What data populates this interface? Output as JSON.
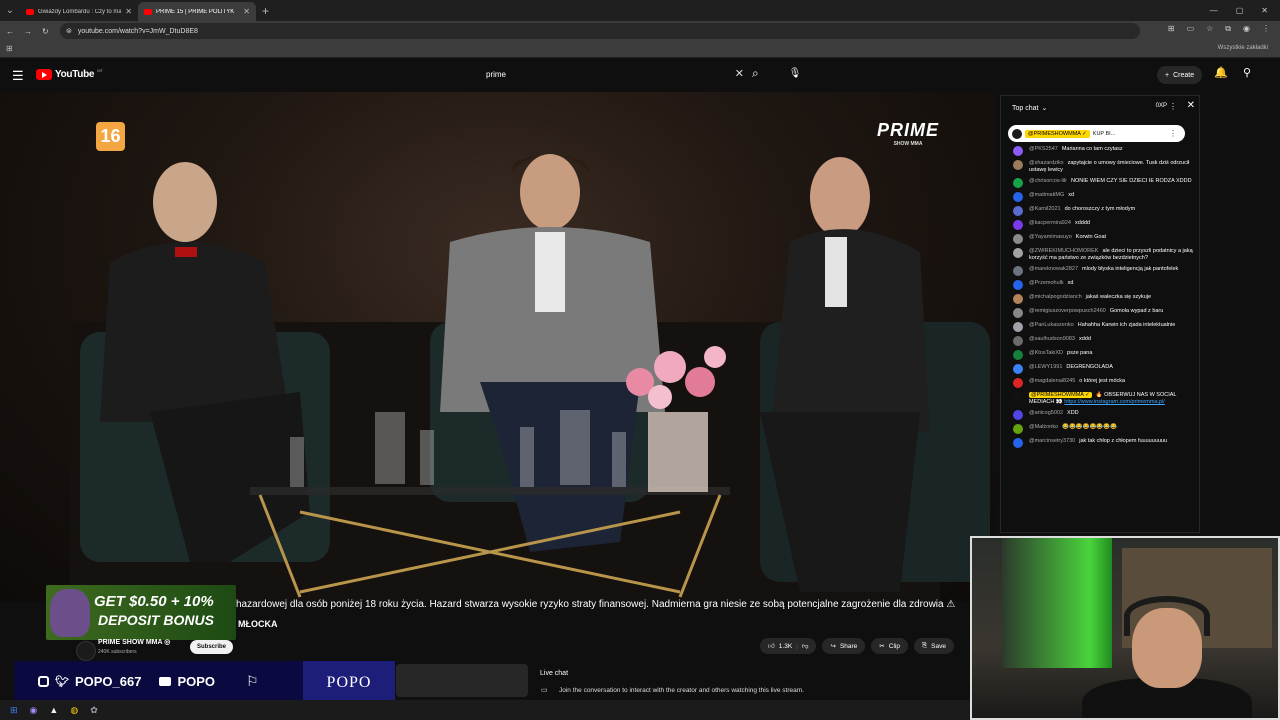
{
  "browser": {
    "tabs": [
      {
        "title": "Gwiazdy Lombardu : Czy to ma",
        "active": false
      },
      {
        "title": "PRIME 15 | PRIME POLITYK",
        "active": true
      }
    ],
    "url": "youtube.com/watch?v=JmW_DtuD8E8",
    "bookmarks_all": "Wszystkie zakładki"
  },
  "youtube": {
    "logo": "YouTube",
    "country_code": "MT",
    "search_value": "prime",
    "create_label": "Create"
  },
  "video": {
    "age_rating": "16",
    "brand": "PRIME",
    "brand_sub": "SHOW MMA",
    "ticker": "hazardowej dla osób poniżej 18 roku życia. Hazard stwarza wysokie ryzyko straty finansowej. Nadmierna gra niesie ze sobą potencjalne zagrożenie dla zdrowia ⚠",
    "guest_name": "MŁOCKA",
    "ad_line1": "GET $0.50 + 10%",
    "ad_line2": "DEPOSIT BONUS"
  },
  "channel": {
    "name": "PRIME SHOW MMA",
    "verified": "◎",
    "subscribers": "240K subscribers",
    "subscribe_label": "Subscribe"
  },
  "actions": {
    "likes": "1.3K",
    "share": "Share",
    "clip": "Clip",
    "save": "Save"
  },
  "overlay": {
    "handle": "POPO_667",
    "yt_name": "POPO",
    "box_text": "POPO"
  },
  "live_chat_bar": {
    "title": "Live chat",
    "description": "Join the conversation to interact with the creator and others watching this live stream."
  },
  "chat": {
    "header": "Top chat",
    "xp": "0XP",
    "pinned": {
      "author": "@PRIMESHOWMMA ✓",
      "text": "KUP BI..."
    },
    "messages": [
      {
        "author": "@PKS2547",
        "text": "Marianna co tam czytasz",
        "color": "#8b5cf6"
      },
      {
        "author": "@shazardzikx",
        "text": "zapytajcie o umowy śmieciowe. Tusk dziś odrzucił ustawę lewicy",
        "color": "#9a7b5a"
      },
      {
        "author": "@chrisorcos-lilr",
        "text": "NONIE WIEM CZY SIE DZIECI IE RODZA XDDD",
        "color": "#16a34a"
      },
      {
        "author": "@matimatiMG",
        "text": "xd",
        "color": "#2563eb"
      },
      {
        "author": "@Kamil2021",
        "text": "do choroszczy z tym młodym",
        "color": "#5b6bd0"
      },
      {
        "author": "@kacpermira924",
        "text": "xdddd",
        "color": "#7c3aed"
      },
      {
        "author": "@Yayamimasuyo",
        "text": "Korwin Goat",
        "color": "#8a8a8a"
      },
      {
        "author": "@ZWIREKIMUCHOMOREK",
        "text": "ale dzieci to przyszli podatnicy a jaką korzyść ma państwo ze związków bezdzietnych?",
        "color": "#a3a3a3"
      },
      {
        "author": "@mareknowak2827",
        "text": "mlody błyska inteligencją jak pantofelek",
        "color": "#6b7280"
      },
      {
        "author": "@Przemohulk",
        "text": "xd",
        "color": "#2563eb"
      },
      {
        "author": "@michalpogodzianch",
        "text": "jakaś waleczka się szykuje",
        "color": "#b4835a"
      },
      {
        "author": "@remigiuszoverpowpusch2460",
        "text": "Gomola wypad z baru",
        "color": "#888888"
      },
      {
        "author": "@PanLukaszenko",
        "text": "Hahahha Karwin ich zjada intelektualnie",
        "color": "#a1a1aa"
      },
      {
        "author": "@saulhudson9083",
        "text": "xddd",
        "color": "#6b6b6b"
      },
      {
        "author": "@KtosTakiXD",
        "text": "psze pana",
        "color": "#15803d"
      },
      {
        "author": "@LEWY1991",
        "text": "DEGRENGOLADA",
        "color": "#3b82f6"
      },
      {
        "author": "@magdalenai8245",
        "text": "o której jest mócka",
        "color": "#dc2626"
      },
      {
        "author": "@PRIMESHOWMMA ✓",
        "text": "🔥 OBSERWUJ NAS W SOCIAL MEDIACH 👀 ",
        "link": "https://www.instagram.com/primemma.pl/",
        "color": "#111111",
        "mod": true
      },
      {
        "author": "@ariicog5002",
        "text": "XDD",
        "color": "#4f46e5"
      },
      {
        "author": "@Małżonko",
        "text": "😂😂😂😂😂😂😂😂",
        "color": "#65a30d"
      },
      {
        "author": "@marcinsetry3730",
        "text": "jak tak chłop z chłopem fuuuuuuuuu",
        "color": "#2563eb"
      }
    ]
  }
}
